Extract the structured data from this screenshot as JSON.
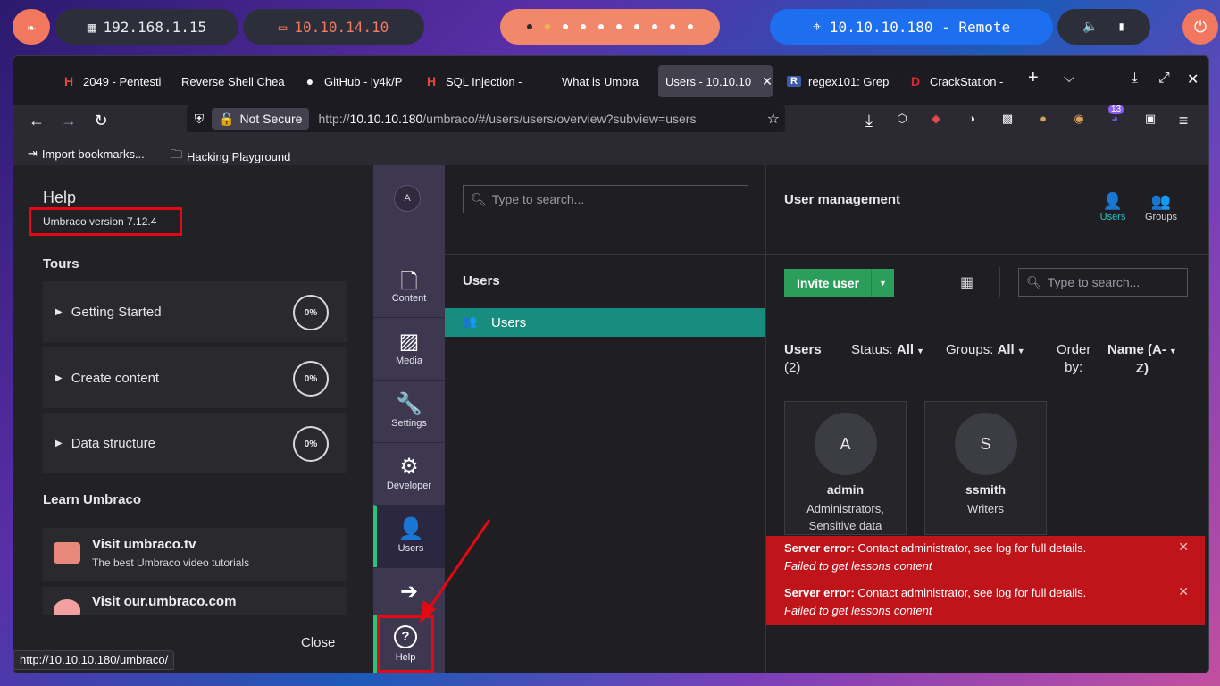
{
  "desktop": {
    "ip_local": "192.168.1.15",
    "ip_vpn": "10.10.14.10",
    "target": "10.10.10.180 - Remote"
  },
  "tabs": [
    {
      "label": "2049 - Pentesti",
      "icon": "hacktricks-icon"
    },
    {
      "label": "Reverse Shell Chea",
      "icon": "none"
    },
    {
      "label": "GitHub - ly4k/P",
      "icon": "github-icon"
    },
    {
      "label": "SQL Injection -",
      "icon": "hacktricks-icon"
    },
    {
      "label": "What is Umbra",
      "icon": "none"
    },
    {
      "label": "Users - 10.10.10",
      "icon": "none",
      "active": true
    },
    {
      "label": "regex101: Grep",
      "icon": "regex101-icon"
    },
    {
      "label": "CrackStation - ",
      "icon": "crackstation-icon"
    }
  ],
  "address": {
    "not_secure": "Not Secure",
    "url_prefix": "http://",
    "url_host": "10.10.10.180",
    "url_path": "/umbraco/#/users/users/overview?subview=users"
  },
  "extensions": {
    "badge": "13"
  },
  "bookmarks": [
    "Import bookmarks...",
    "Hacking Playground"
  ],
  "help": {
    "title": "Help",
    "version": "Umbraco version 7.12.4",
    "tours_label": "Tours",
    "tours": [
      {
        "label": "Getting Started",
        "progress": "0%"
      },
      {
        "label": "Create content",
        "progress": "0%"
      },
      {
        "label": "Data structure",
        "progress": "0%"
      }
    ],
    "learn_label": "Learn Umbraco",
    "learn": [
      {
        "title": "Visit umbraco.tv",
        "subtitle": "The best Umbraco video tutorials"
      },
      {
        "title": "Visit our.umbraco.com",
        "subtitle": ""
      }
    ],
    "close": "Close",
    "status_url": "http://10.10.10.180/umbraco/"
  },
  "sections": {
    "avatar": "A",
    "items": [
      "Content",
      "Media",
      "Settings",
      "Developer",
      "Users"
    ],
    "help": "Help"
  },
  "tree": {
    "search_placeholder": "Type to search...",
    "title": "Users",
    "item": "Users"
  },
  "main": {
    "title": "User management",
    "tab_users": "Users",
    "tab_groups": "Groups",
    "invite": "Invite user",
    "search_placeholder": "Type to search...",
    "users_label": "Users",
    "users_count": "(2)",
    "status_label": "Status:",
    "status_value": "All",
    "groups_label": "Groups:",
    "groups_value": "All",
    "order_label_1": "Order",
    "order_label_2": "by:",
    "order_value_1": "Name (A-",
    "order_value_2": "Z)",
    "users": [
      {
        "initial": "A",
        "name": "admin",
        "groups_1": "Administrators,",
        "groups_2": "Sensitive data"
      },
      {
        "initial": "S",
        "name": "ssmith",
        "groups_1": "Writers",
        "groups_2": ""
      }
    ],
    "errors": [
      {
        "label": "Server error:",
        "msg": "Contact administrator, see log for full details.",
        "detail": "Failed to get lessons content"
      },
      {
        "label": "Server error:",
        "msg": "Contact administrator, see log for full details.",
        "detail": "Failed to get lessons content"
      }
    ]
  },
  "colors": {
    "accent": "#2bc37c",
    "tree_active": "#198c80",
    "error": "#c0141b",
    "highlight": "#e50914"
  }
}
